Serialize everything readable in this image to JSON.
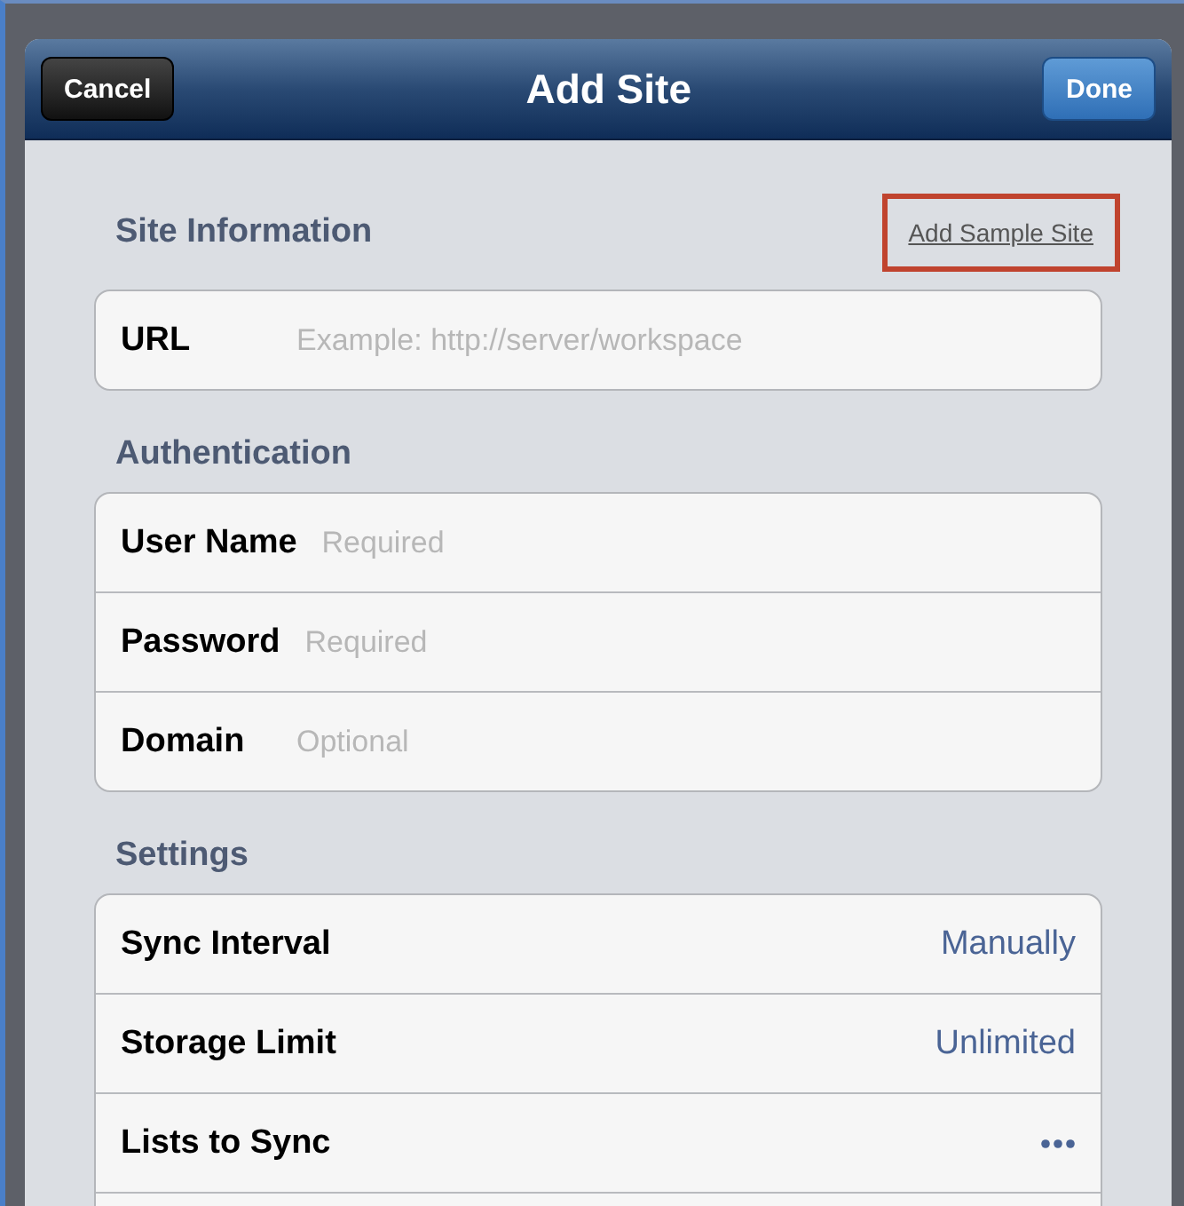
{
  "navigation_bar": {
    "title": "Add Site",
    "left_button": "Cancel",
    "right_button": "Done"
  },
  "sections": [
    {
      "header": "Site Information",
      "link": {
        "label": "Add Sample Site",
        "highlighted": true
      },
      "rows": [
        {
          "kind": "field",
          "label": "URL",
          "placeholder": "Example: http://server/workspace"
        }
      ]
    },
    {
      "header": "Authentication",
      "rows": [
        {
          "kind": "field",
          "label": "User Name",
          "placeholder": "Required"
        },
        {
          "kind": "field",
          "label": "Password",
          "placeholder": "Required"
        },
        {
          "kind": "field",
          "label": "Domain",
          "placeholder": "Optional"
        }
      ]
    },
    {
      "header": "Settings",
      "rows": [
        {
          "kind": "value",
          "label": "Sync Interval",
          "value": "Manually"
        },
        {
          "kind": "value",
          "label": "Storage Limit",
          "value": "Unlimited"
        },
        {
          "kind": "more",
          "label": "Lists to Sync"
        }
      ]
    }
  ]
}
